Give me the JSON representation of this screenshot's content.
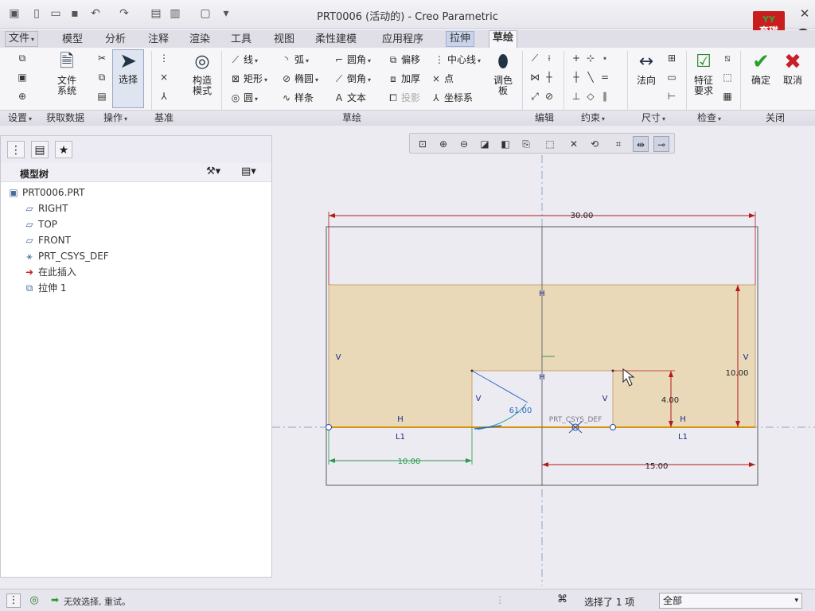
{
  "window": {
    "title": "PRT0006 (活动的) - Creo Parametric"
  },
  "logo": {
    "top": "YY",
    "line1": "育碟",
    "line2": "软件"
  },
  "help_label": "?",
  "menu": {
    "file": "文件",
    "tabs": [
      "模型",
      "分析",
      "注释",
      "渲染",
      "工具",
      "视图",
      "柔性建模",
      "应用程序"
    ],
    "extrude": "拉伸",
    "sketch": "草绘"
  },
  "ribbon": {
    "file_system": "文件\n系统",
    "select": "选择",
    "construct_mode": "构造\n模式",
    "line": "线",
    "rectangle": "矩形",
    "circle": "圆",
    "arc": "弧",
    "ellipse": "椭圆",
    "spline": "样条",
    "fillet": "圆角",
    "chamfer": "倒角",
    "text": "文本",
    "offset": "偏移",
    "thicken": "加厚",
    "project": "投影",
    "centerline": "中心线",
    "point": "点",
    "coord_sys": "坐标系",
    "palette": "调色\n板",
    "normal": "法向",
    "feature_req": "特征\n要求",
    "ok": "确定",
    "cancel": "取消",
    "groups": {
      "setup": "设置",
      "get_data": "获取数据",
      "operations": "操作",
      "datum": "基准",
      "sketching": "草绘",
      "editing": "编辑",
      "constrain": "约束",
      "dimension": "尺寸",
      "inspect": "检查",
      "close": "关闭"
    }
  },
  "model_tree": {
    "title": "模型树",
    "items": [
      {
        "label": "PRT0006.PRT",
        "icon": "part-icon"
      },
      {
        "label": "RIGHT",
        "icon": "datum-plane-icon"
      },
      {
        "label": "TOP",
        "icon": "datum-plane-icon"
      },
      {
        "label": "FRONT",
        "icon": "datum-plane-icon"
      },
      {
        "label": "PRT_CSYS_DEF",
        "icon": "csys-icon"
      },
      {
        "label": "在此插入",
        "icon": "insert-arrow-icon"
      },
      {
        "label": "拉伸 1",
        "icon": "extrude-icon"
      }
    ]
  },
  "sketch": {
    "dims": {
      "total_width": "30.00",
      "height": "10.00",
      "notch_height": "4.00",
      "left_offset": "10.00",
      "right_offset": "15.00",
      "angle": "61.00"
    },
    "labels": {
      "h": "H",
      "v": "V",
      "l1": "L1",
      "csys": "PRT_CSYS_DEF"
    }
  },
  "status": {
    "message": "无效选择, 重试。",
    "selected": "选择了 1 项",
    "filter": "全部"
  }
}
